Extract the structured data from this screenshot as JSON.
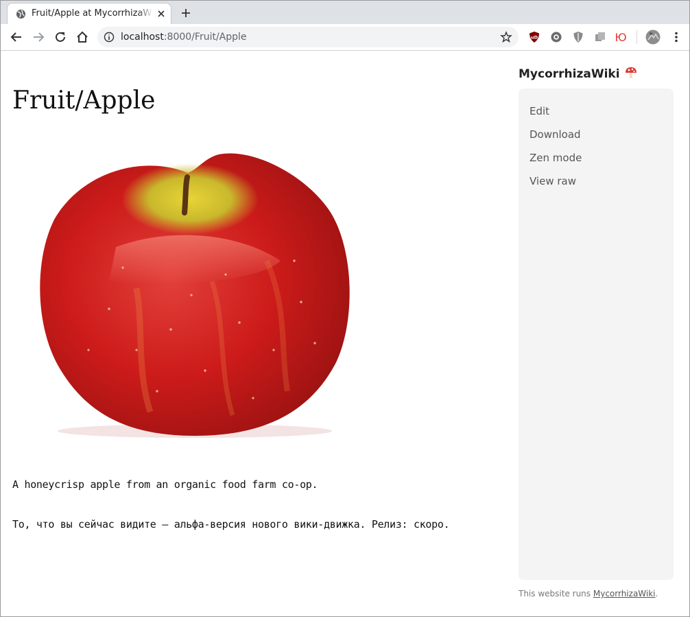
{
  "browser": {
    "tab_title": "Fruit/Apple at MycorrhizaWiki",
    "url_host": "localhost",
    "url_rest": ":8000/Fruit/Apple",
    "extensions": {
      "ublock_label": "uD",
      "yandex_label": "Ю"
    }
  },
  "page": {
    "title": "Fruit/Apple",
    "image_alt": "apple-photo",
    "paragraphs": [
      "A honeycrisp apple from an organic food farm co-op.",
      "То, что вы сейчас видите — альфа-версия нового вики-движка. Релиз: скоро."
    ]
  },
  "sidebar": {
    "brand": "MycorrhizaWiki",
    "links": [
      "Edit",
      "Download",
      "Zen mode",
      "View raw"
    ]
  },
  "footer": {
    "prefix": "This website runs ",
    "link": "MycorrhizaWiki",
    "suffix": "."
  },
  "colors": {
    "tab_strip": "#dee1e6",
    "omnibox": "#f1f3f4",
    "sidebar_bg": "#f4f4f4",
    "link_text": "#555555",
    "apple_red": "#d21f1c"
  }
}
